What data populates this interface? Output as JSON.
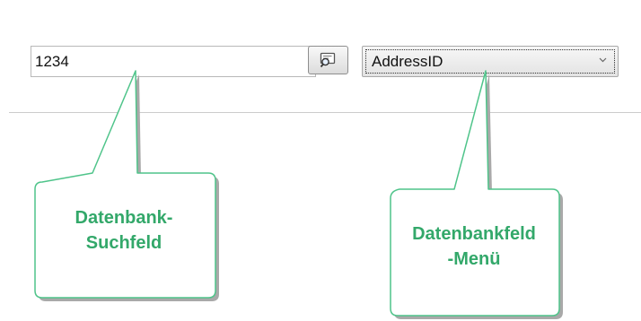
{
  "search": {
    "value": "1234"
  },
  "search_button": {
    "icon": "database-search-icon"
  },
  "field_menu": {
    "selected": "AddressID",
    "icon": "chevron-down-icon"
  },
  "callouts": {
    "search_field": {
      "line1": "Datenbank-",
      "line2": "Suchfeld"
    },
    "field_menu": {
      "line1": "Datenbankfeld",
      "line2": "-Menü"
    }
  },
  "colors": {
    "callout_text": "#33a86a",
    "callout_border": "#4fc48a",
    "callout_shadow": "#a9a9a9"
  }
}
